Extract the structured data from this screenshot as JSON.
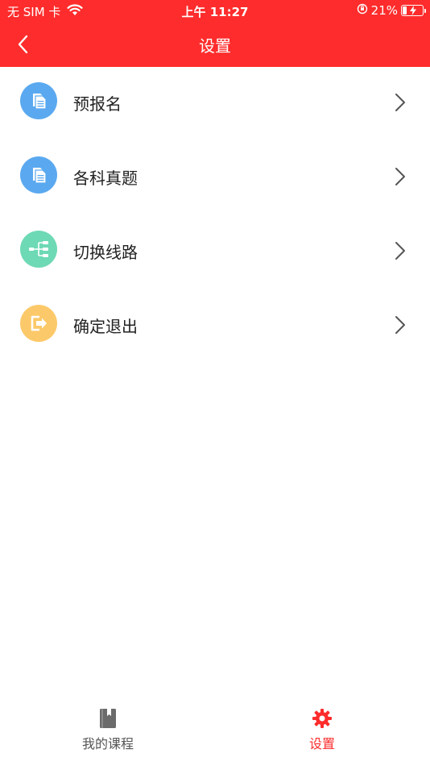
{
  "status_bar": {
    "carrier": "无 SIM 卡",
    "time": "上午 11:27",
    "battery_percent": "21%",
    "battery_level": 0.21,
    "icons": [
      "wifi-icon",
      "orientation-lock-icon",
      "battery-charging-icon"
    ]
  },
  "navbar": {
    "title": "设置",
    "back_icon": "chevron-left-icon"
  },
  "menu": {
    "items": [
      {
        "label": "预报名",
        "icon": "document-icon",
        "color": "#5aa9f0"
      },
      {
        "label": "各科真题",
        "icon": "document-icon",
        "color": "#5aa9f0"
      },
      {
        "label": "切换线路",
        "icon": "network-tree-icon",
        "color": "#6ed9b5"
      },
      {
        "label": "确定退出",
        "icon": "exit-icon",
        "color": "#fcc96a"
      }
    ]
  },
  "tabbar": {
    "tabs": [
      {
        "label": "我的课程",
        "icon": "bookmark-book-icon",
        "active": false
      },
      {
        "label": "设置",
        "icon": "gear-icon",
        "active": true
      }
    ]
  },
  "colors": {
    "brand": "#fe2c2c",
    "text": "#222222",
    "inactive": "#555555"
  }
}
